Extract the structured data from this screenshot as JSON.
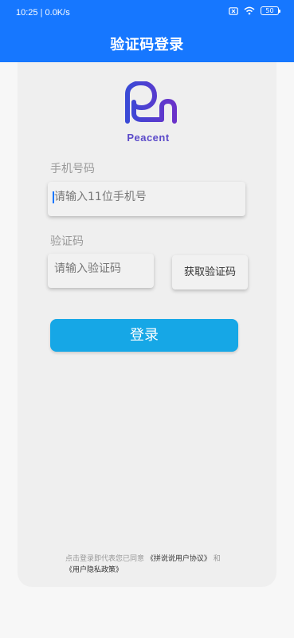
{
  "status_bar": {
    "time": "10:25",
    "network_speed": "0.0K/s",
    "battery": "50",
    "icons": [
      "close-box-icon",
      "wifi-icon",
      "battery-icon"
    ]
  },
  "header": {
    "title": "验证码登录",
    "accent_color": "#1677ff"
  },
  "logo": {
    "icon": "elephant-logo-icon",
    "text": "Peacent",
    "gradient": [
      "#3a4ad6",
      "#6a32c9"
    ]
  },
  "form": {
    "phone_label": "手机号码",
    "phone_placeholder": "请输入11位手机号",
    "code_label": "验证码",
    "code_placeholder": "请输入验证码",
    "get_code_label": "获取验证码",
    "login_label": "登录",
    "login_color": "#16a7e6"
  },
  "agreement": {
    "prefix": "点击登录即代表您已同意",
    "user_agreement": "《拼说说用户协议》",
    "conjunction": "和",
    "privacy_policy": "《用户隐私政策》"
  }
}
